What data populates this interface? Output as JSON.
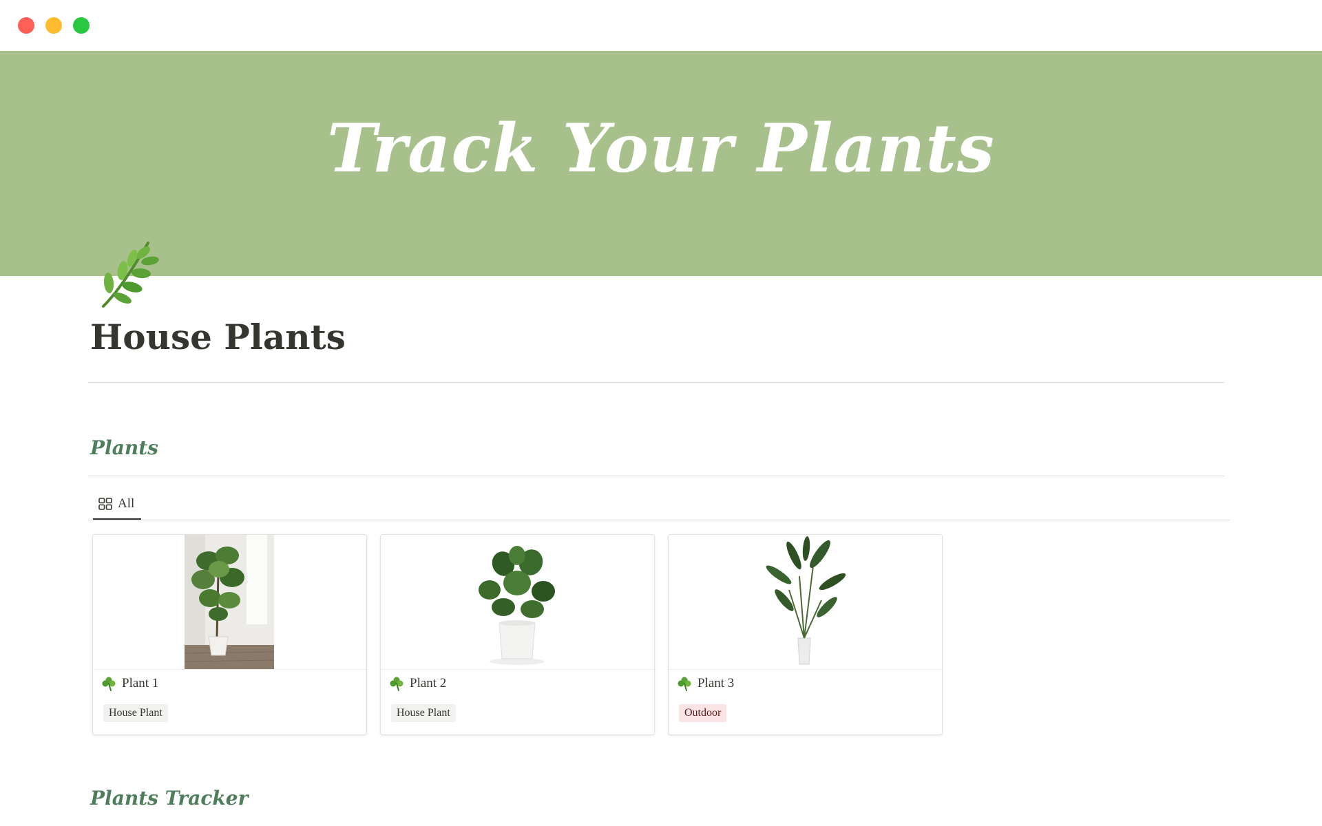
{
  "window": {
    "controls": [
      "close",
      "minimize",
      "zoom"
    ]
  },
  "cover": {
    "title": "Track Your Plants",
    "color": "#a8c08c"
  },
  "page": {
    "icon": "herb-icon",
    "title": "House Plants"
  },
  "sections": {
    "plants_heading": "Plants",
    "tracker_heading": "Plants Tracker"
  },
  "views": {
    "tabs": [
      {
        "label": "All",
        "icon": "gallery-grid-icon",
        "active": true
      }
    ]
  },
  "cards": [
    {
      "title": "Plant 1",
      "icon": "shamrock-icon",
      "tag": "House Plant",
      "tag_color": "#f1f1ef",
      "tag_text_color": "#37352f"
    },
    {
      "title": "Plant 2",
      "icon": "shamrock-icon",
      "tag": "House Plant",
      "tag_color": "#f1f1ef",
      "tag_text_color": "#37352f"
    },
    {
      "title": "Plant 3",
      "icon": "shamrock-icon",
      "tag": "Outdoor",
      "tag_color": "#fbe4e4",
      "tag_text_color": "#5d1715"
    }
  ],
  "colors": {
    "heading_green": "#4e7d5b",
    "text": "#37352f"
  }
}
